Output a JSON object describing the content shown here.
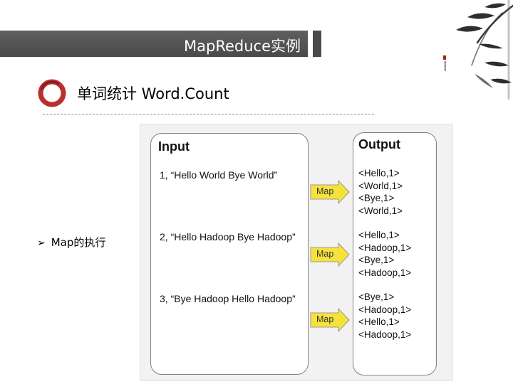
{
  "slide": {
    "title": "MapReduce实例",
    "section_heading": "单词统计 Word.Count",
    "bullet_text": "Map的执行"
  },
  "diagram": {
    "input_header": "Input",
    "output_header": "Output",
    "map_label": "Map",
    "input_lines": [
      "1, “Hello World Bye World”",
      "2, “Hello Hadoop Bye Hadoop”",
      "3, “Bye Hadoop Hello Hadoop”"
    ],
    "output_groups": [
      [
        "<Hello,1>",
        "<World,1>",
        "<Bye,1>",
        "<World,1>"
      ],
      [
        "<Hello,1>",
        "<Hadoop,1>",
        "<Bye,1>",
        "<Hadoop,1>"
      ],
      [
        "<Bye,1>",
        "<Hadoop,1>",
        "<Hello,1>",
        "<Hadoop,1>"
      ]
    ]
  },
  "colors": {
    "title_bar": "#4a4a4a",
    "ring_outer": "#b8312f",
    "arrow_fill": "#f5e23a"
  },
  "icons": [
    "ring-icon",
    "bullet-arrow-icon",
    "map-arrow-icon",
    "bamboo-decoration"
  ]
}
